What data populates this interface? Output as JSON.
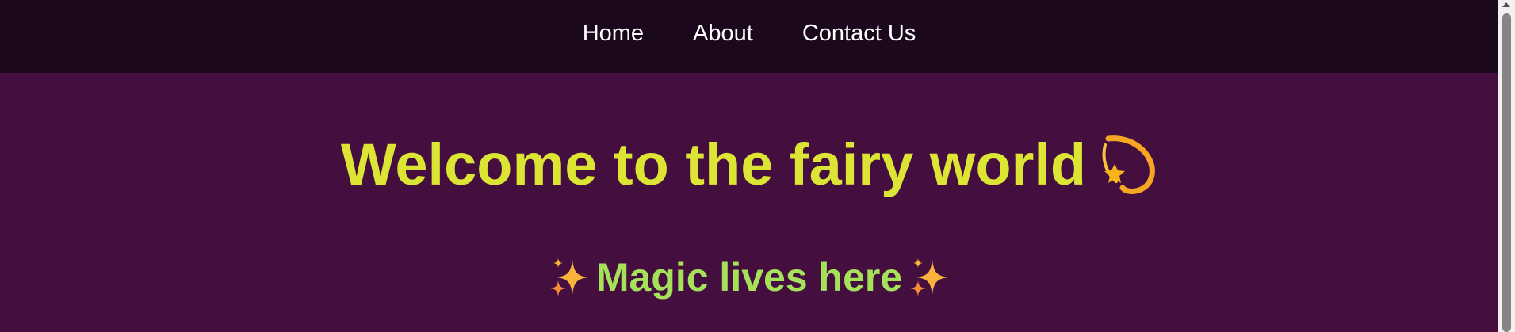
{
  "nav": {
    "items": [
      {
        "label": "Home"
      },
      {
        "label": "About"
      },
      {
        "label": "Contact Us"
      }
    ]
  },
  "hero": {
    "title": "Welcome to the fairy world",
    "title_icon": "dizzy-star-icon",
    "subtitle": "Magic lives here",
    "subtitle_icon": "sparkles-icon"
  },
  "colors": {
    "nav_background": "#1b081d",
    "page_background": "#440e3e",
    "title": "#dde534",
    "subtitle": "#a5e25a",
    "nav_text": "#ffffff"
  }
}
